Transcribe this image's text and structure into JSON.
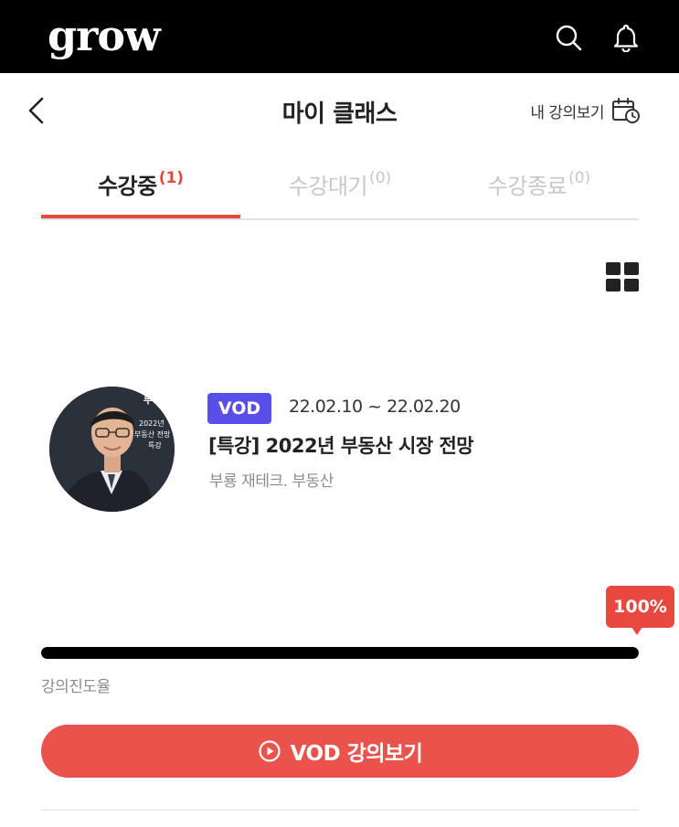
{
  "app": {
    "logo": "grow"
  },
  "topbar": {
    "icons": [
      "search-icon",
      "bell-icon"
    ]
  },
  "header": {
    "title": "마이 클래스",
    "my_lecture_label": "내 강의보기",
    "icons": [
      "back-arrow-icon",
      "calendar-clock-icon"
    ]
  },
  "tabs": [
    {
      "label": "수강중",
      "count": "(1)",
      "active": true
    },
    {
      "label": "수강대기",
      "count": "(0)",
      "active": false
    },
    {
      "label": "수강종료",
      "count": "(0)",
      "active": false
    }
  ],
  "view_toggle": {
    "icon": "grid-view-icon"
  },
  "class_item": {
    "badge": "VOD",
    "period": "22.02.10 ~ 22.02.20",
    "title": "[특강] 2022년 부동산 시장 전망",
    "category": "부룡 재테크. 부동산",
    "thumbnail_text": [
      "부",
      "2022년",
      "부동산 전망",
      "특강"
    ]
  },
  "progress": {
    "value_label": "100%",
    "value": 1.0,
    "label": "강의진도율"
  },
  "vod_button": {
    "label": "VOD 강의보기",
    "icon": "play-circle-icon"
  },
  "colors": {
    "accent": "#e9483f",
    "badge": "#5a4ee8",
    "topbar": "#000000",
    "progress_fill": "#000000"
  }
}
